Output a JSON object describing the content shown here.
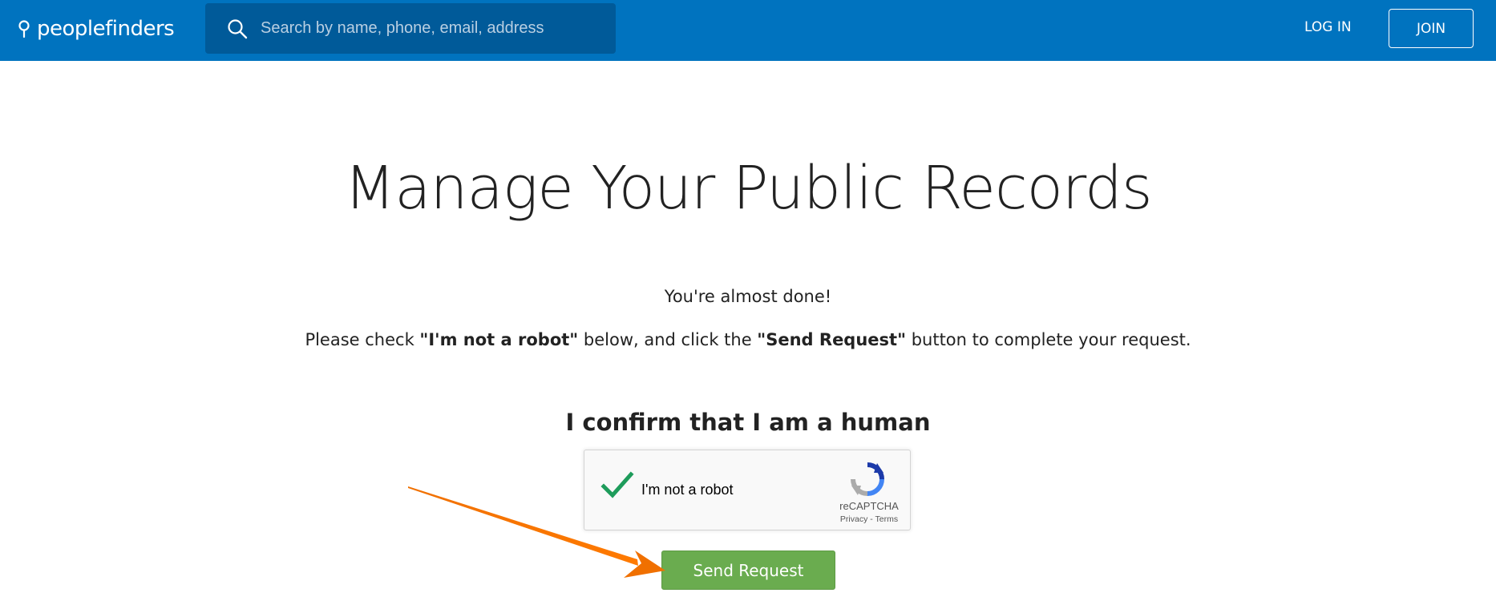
{
  "header": {
    "logo_text": "peoplefinders",
    "search_placeholder": "Search by name, phone, email, address",
    "login_label": "LOG IN",
    "join_label": "JOIN",
    "brand_color": "#0073bf"
  },
  "main": {
    "title": "Manage Your Public Records",
    "almost_done": "You're almost done!",
    "instructions": {
      "part1": "Please check ",
      "bold1": "\"I'm not a robot\"",
      "part2": " below, and click the ",
      "bold2": "\"Send Request\"",
      "part3": " button to complete your request."
    },
    "confirm_heading": "I confirm that I am a human"
  },
  "recaptcha": {
    "label": "I'm not a robot",
    "brand": "reCAPTCHA",
    "privacy": "Privacy",
    "separator": " - ",
    "terms": "Terms",
    "checked": true
  },
  "send_button": {
    "label": "Send Request",
    "color": "#6aac4f"
  },
  "annotation": {
    "arrow_color": "#f07000",
    "icon": "arrow-pointer-icon"
  }
}
